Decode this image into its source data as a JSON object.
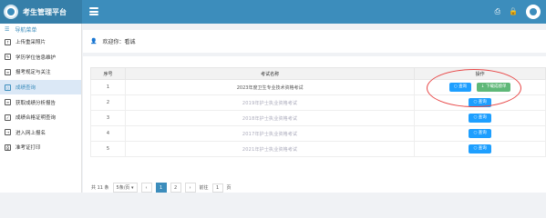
{
  "header": {
    "app_title": "考生管理平台",
    "icons": [
      "menu-icon",
      "print-icon",
      "lock-icon",
      "avatar-icon"
    ]
  },
  "sidebar": {
    "section_title": "导航菜单",
    "items": [
      {
        "label": "上传重采照片",
        "icon": "upload-icon"
      },
      {
        "label": "学历学位信息维护",
        "icon": "edit-icon"
      },
      {
        "label": "报考规定与关注",
        "icon": "doc-icon"
      },
      {
        "label": "成绩查询",
        "icon": "search-icon",
        "active": true
      },
      {
        "label": "获取成绩分析报告",
        "icon": "report-icon"
      },
      {
        "label": "成绩合格证明查询",
        "icon": "cert-icon"
      },
      {
        "label": "进入网上报名",
        "icon": "enter-icon"
      },
      {
        "label": "准考证打印",
        "icon": "print-icon"
      }
    ]
  },
  "welcome": {
    "text": "欢迎你：看诚"
  },
  "table": {
    "headers": [
      "序号",
      "考试名称",
      "操作"
    ],
    "rows": [
      {
        "no": "1",
        "name": "2023年度卫生专业技术资格考试",
        "buttons": [
          "查询",
          "下载成绩单"
        ],
        "blurred": false
      },
      {
        "no": "2",
        "name": "2019年护士执业资格考试",
        "buttons": [
          "查询"
        ],
        "blurred": true
      },
      {
        "no": "3",
        "name": "2018年护士执业资格考试",
        "buttons": [
          "查询"
        ],
        "blurred": true
      },
      {
        "no": "4",
        "name": "2017年护士执业资格考试",
        "buttons": [
          "查询"
        ],
        "blurred": true
      },
      {
        "no": "5",
        "name": "2021年护士执业资格考试",
        "buttons": [
          "查询"
        ],
        "blurred": true
      }
    ]
  },
  "pager": {
    "total": "共 11 条",
    "per_page": "5条/页",
    "prev": "‹",
    "pages": [
      "1",
      "2"
    ],
    "next": "›",
    "goto_label": "前往",
    "goto_value": "1",
    "page_suffix": "页"
  },
  "colors": {
    "header": "#3c8dbc",
    "active_menu_bg": "#dbe8f6",
    "query_button": "#1e9fff",
    "download_button": "#5fb878",
    "annotation_circle": "#e84848"
  }
}
